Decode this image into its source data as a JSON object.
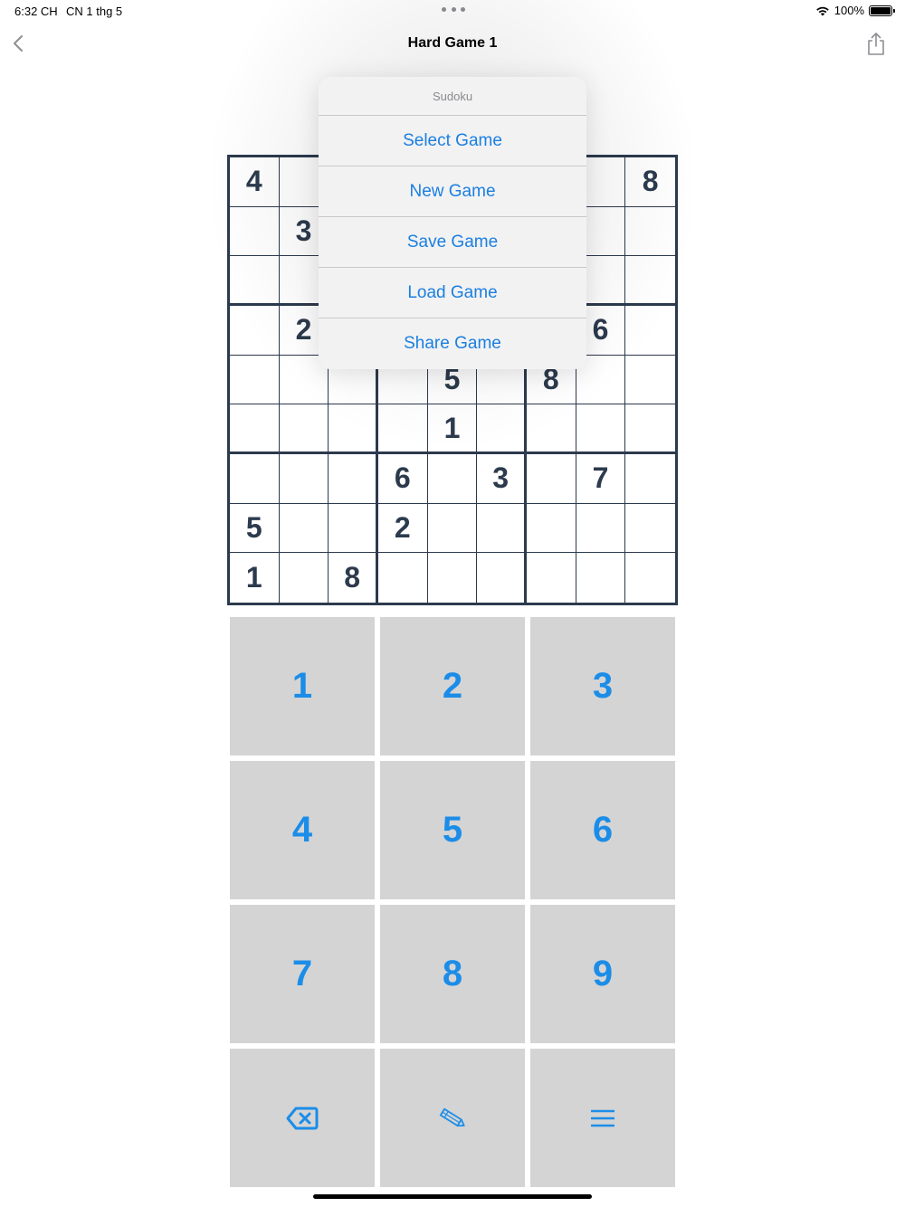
{
  "status_bar": {
    "time": "6:32 CH",
    "date": "CN 1 thg 5",
    "battery": "100%"
  },
  "nav": {
    "title": "Hard Game 1"
  },
  "grid": [
    [
      "4",
      "",
      "",
      "",
      "",
      "",
      "",
      "",
      "8"
    ],
    [
      "",
      "3",
      "",
      "",
      "",
      "",
      "",
      "",
      ""
    ],
    [
      "",
      "",
      "",
      "",
      "",
      "",
      "",
      "",
      ""
    ],
    [
      "",
      "2",
      "",
      "",
      "",
      "",
      "",
      "6",
      ""
    ],
    [
      "",
      "",
      "",
      "",
      "5",
      "",
      "8",
      "",
      ""
    ],
    [
      "",
      "",
      "",
      "",
      "1",
      "",
      "",
      "",
      ""
    ],
    [
      "",
      "",
      "",
      "6",
      "",
      "3",
      "",
      "7",
      ""
    ],
    [
      "5",
      "",
      "",
      "2",
      "",
      "",
      "",
      "",
      ""
    ],
    [
      "1",
      "",
      "8",
      "",
      "",
      "",
      "",
      "",
      ""
    ]
  ],
  "keypad": {
    "digits": [
      "1",
      "2",
      "3",
      "4",
      "5",
      "6",
      "7",
      "8",
      "9"
    ],
    "actions": [
      {
        "name": "delete-icon"
      },
      {
        "name": "pencil-icon"
      },
      {
        "name": "menu-icon"
      }
    ],
    "accent_color": "#1b8de8",
    "key_background": "#d4d4d4"
  },
  "popover": {
    "title": "Sudoku",
    "items": [
      "Select Game",
      "New Game",
      "Save Game",
      "Load Game",
      "Share Game"
    ],
    "item_color": "#1b7fe0"
  },
  "colors": {
    "grid_line": "#2c3a4d",
    "given_digit": "#2c3a4d"
  }
}
